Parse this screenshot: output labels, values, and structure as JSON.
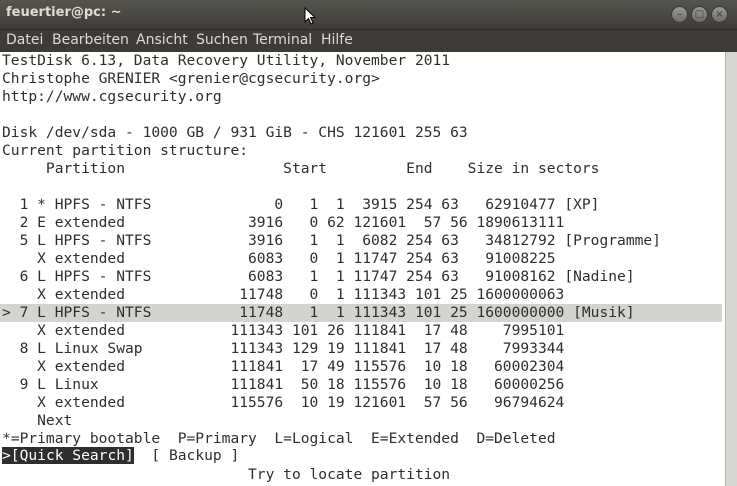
{
  "window": {
    "title": "feuertier@pc: ~"
  },
  "menu": [
    "Datei",
    "Bearbeiten",
    "Ansicht",
    "Suchen",
    "Terminal",
    "Hilfe"
  ],
  "terminal": {
    "lines": [
      "TestDisk 6.13, Data Recovery Utility, November 2011",
      "Christophe GRENIER <grenier@cgsecurity.org>",
      "http://www.cgsecurity.org",
      "",
      "Disk /dev/sda - 1000 GB / 931 GiB - CHS 121601 255 63",
      "Current partition structure:",
      "     Partition                  Start         End    Size in sectors",
      "",
      "  1 * HPFS - NTFS              0   1  1  3915 254 63   62910477 [XP]",
      "  2 E extended              3916   0 62 121601  57 56 1890613111",
      "  5 L HPFS - NTFS           3916   1  1  6082 254 63   34812792 [Programme]",
      "    X extended              6083   0  1 11747 254 63   91008225",
      "  6 L HPFS - NTFS           6083   1  1 11747 254 63   91008162 [Nadine]",
      "    X extended             11748   0  1 111343 101 25 1600000063",
      "> 7 L HPFS - NTFS          11748   1  1 111343 101 25 1600000000 [Musik]",
      "    X extended            111343 101 26 111841  17 48    7995101",
      "  8 L Linux Swap          111343 129 19 111841  17 48    7993344",
      "    X extended            111841  17 49 115576  10 18   60002304",
      "  9 L Linux               111841  50 18 115576  10 18   60000256",
      "    X extended            115576  10 19 121601  57 56   96794624",
      "    Next",
      "*=Primary bootable  P=Primary  L=Logical  E=Extended  D=Deleted"
    ],
    "quick_search_prefix": ">",
    "quick_search_label": "[Quick Search]",
    "backup_label": "  [ Backup ]",
    "footer": "                            Try to locate partition"
  }
}
